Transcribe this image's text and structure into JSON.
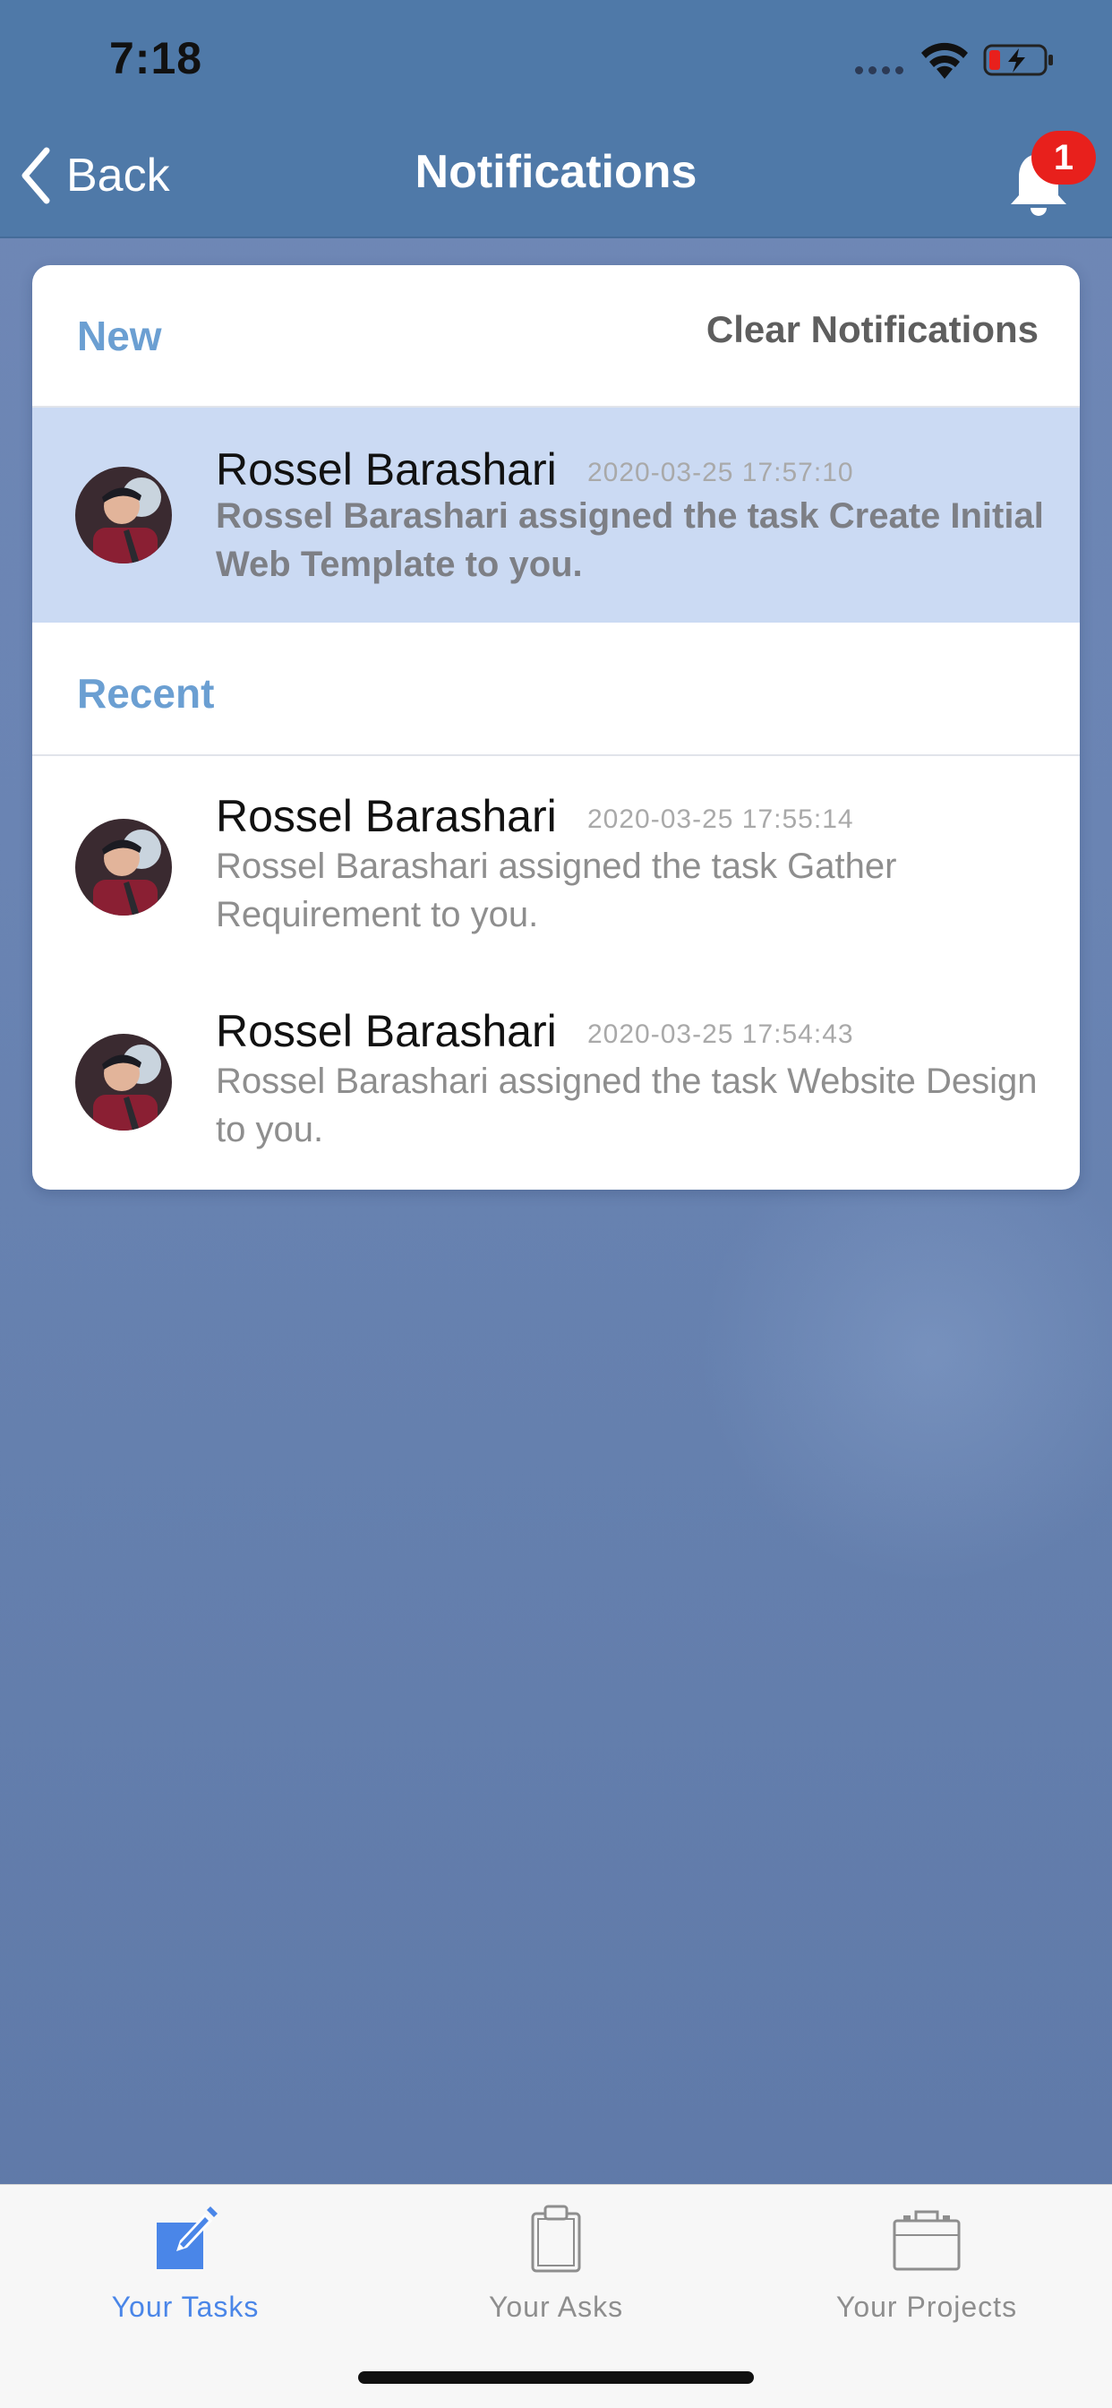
{
  "status_bar": {
    "time": "7:18"
  },
  "nav": {
    "back_label": "Back",
    "title": "Notifications",
    "badge_count": "1"
  },
  "sections": {
    "new": {
      "title": "New",
      "clear_label": "Clear Notifications"
    },
    "recent": {
      "title": "Recent"
    }
  },
  "notifications": {
    "new": [
      {
        "name": "Rossel Barashari",
        "time": "2020-03-25 17:57:10",
        "message": "Rossel Barashari assigned the task Create Initial Web Template to you."
      }
    ],
    "recent": [
      {
        "name": "Rossel Barashari",
        "time": "2020-03-25 17:55:14",
        "message": "Rossel Barashari assigned the task Gather Requirement to you."
      },
      {
        "name": "Rossel Barashari",
        "time": "2020-03-25 17:54:43",
        "message": "Rossel Barashari assigned the task Website Design to you."
      }
    ]
  },
  "tabs": [
    {
      "label": "Your Tasks",
      "icon": "edit-icon",
      "active": true
    },
    {
      "label": "Your Asks",
      "icon": "clipboard-icon",
      "active": false
    },
    {
      "label": "Your Projects",
      "icon": "briefcase-icon",
      "active": false
    }
  ],
  "colors": {
    "nav_bar": "#4f79a8",
    "accent": "#4a86e8",
    "section_title": "#6b9fd2",
    "unread_row": "#cbdaf3",
    "badge": "#e8201c"
  }
}
